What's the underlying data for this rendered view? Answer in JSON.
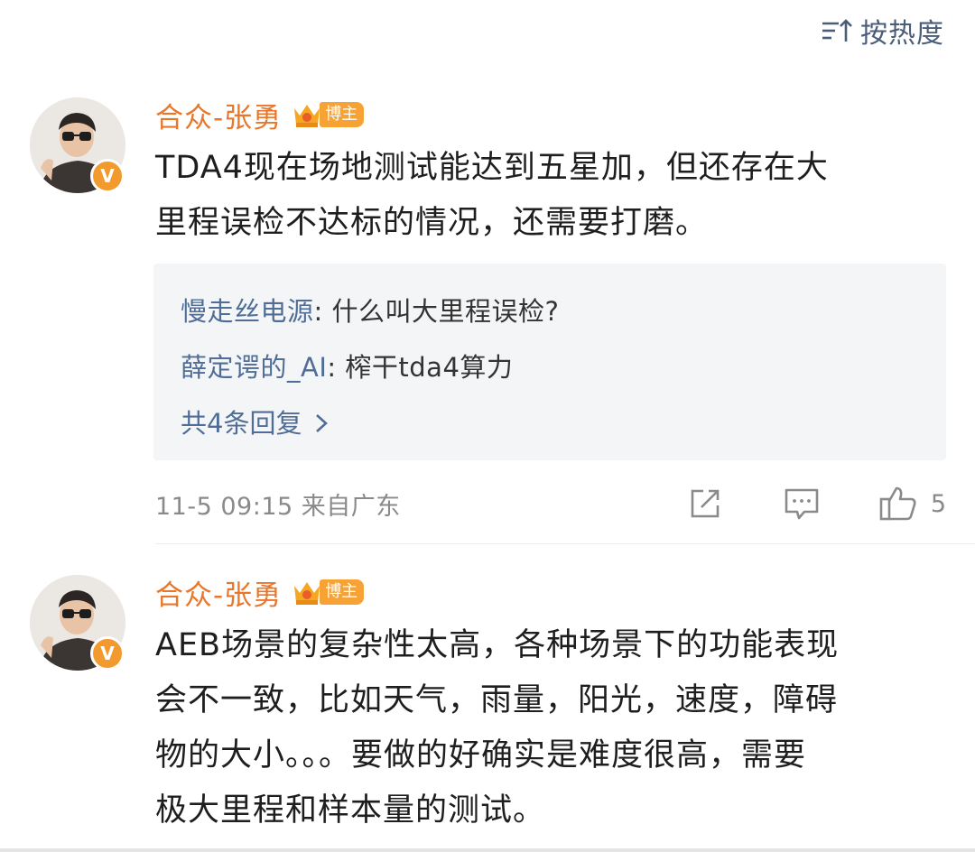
{
  "sort": {
    "label": "按热度",
    "icon": "sort-icon"
  },
  "comments": [
    {
      "author": "合众-张勇",
      "badge": "博主",
      "verified": "V",
      "text_lines": [
        "TDA4现在场地测试能达到五星加，但还存在大",
        "里程误检不达标的情况，还需要打磨。"
      ],
      "replies": [
        {
          "name": "慢走丝电源",
          "sep": ": ",
          "text": "什么叫大里程误检?"
        },
        {
          "name": "薛定谔的_AI",
          "sep": ": ",
          "text": "榨干tda4算力"
        }
      ],
      "reply_more": "共4条回复",
      "meta": "11-5 09:15  来自广东",
      "likes": "5"
    },
    {
      "author": "合众-张勇",
      "badge": "博主",
      "verified": "V",
      "text_lines": [
        "AEB场景的复杂性太高，各种场景下的功能表现",
        "会不一致，比如天气，雨量，阳光，速度，障碍",
        "物的大小。。。要做的好确实是难度很高，需要",
        "极大里程和样本量的测试。"
      ]
    }
  ],
  "colors": {
    "author": "#e8772b",
    "link": "#4f6d96",
    "badge": "#f7a234",
    "meta": "#8a8a8a"
  }
}
